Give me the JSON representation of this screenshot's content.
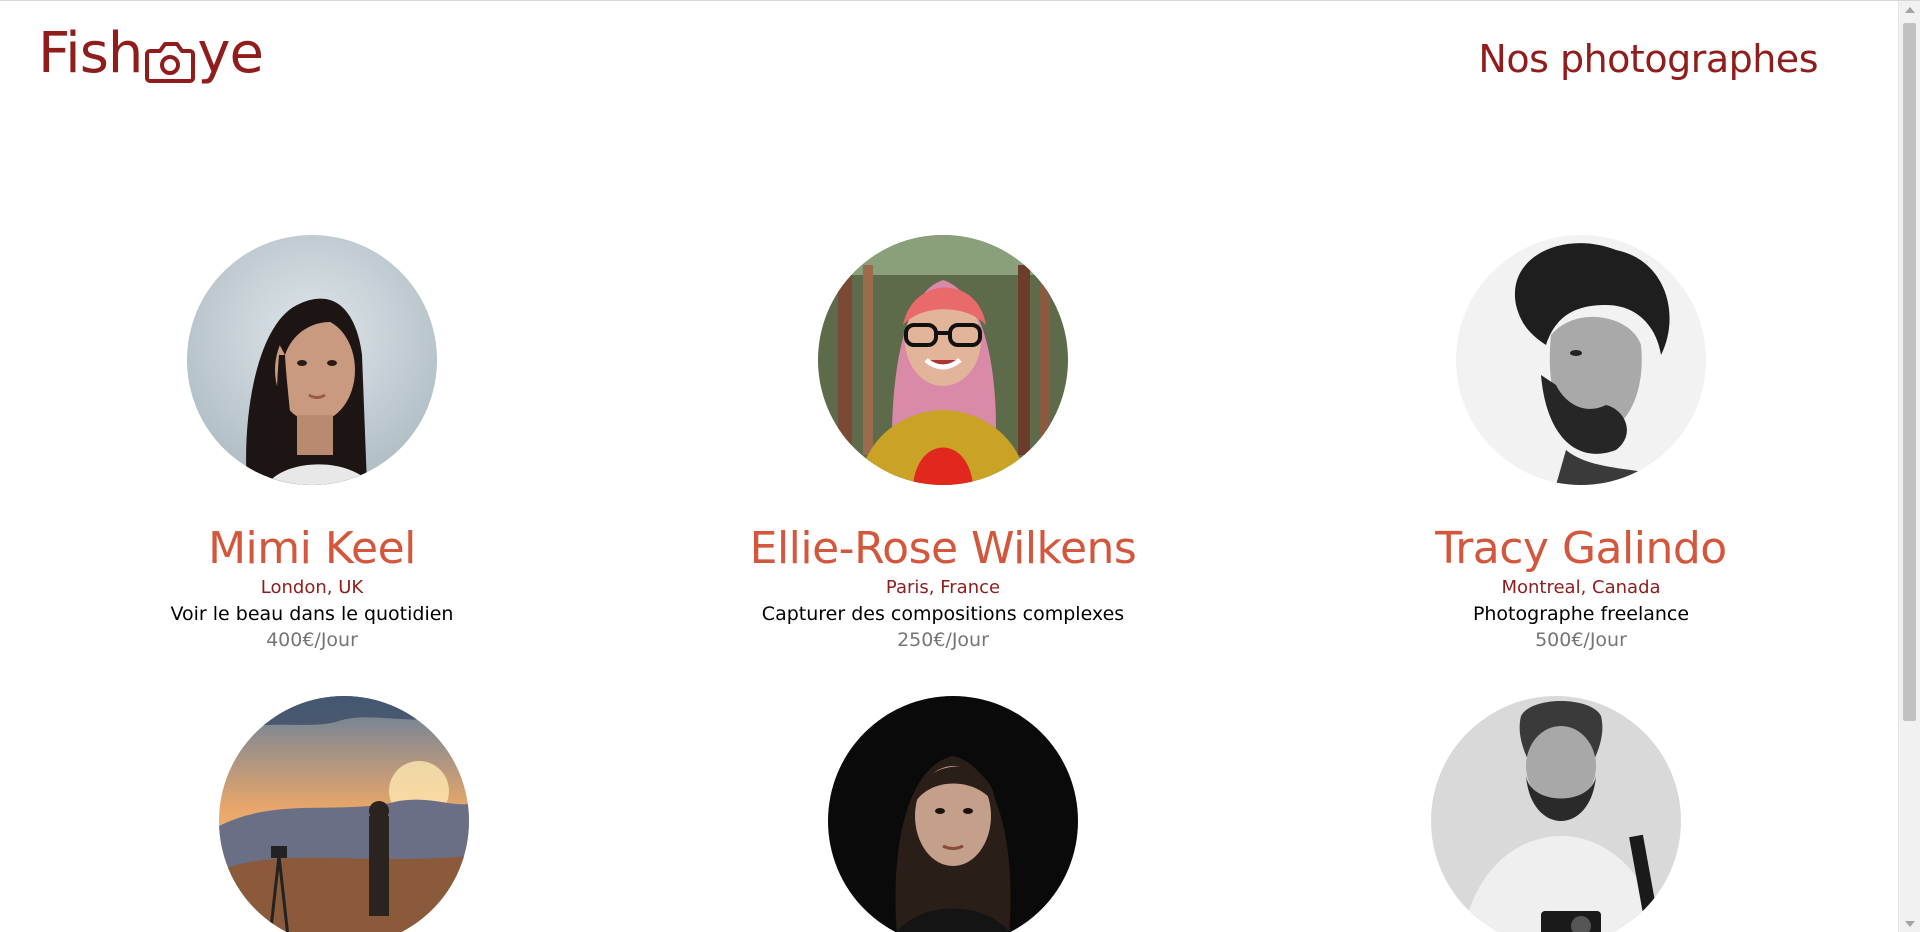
{
  "header": {
    "logo_text_before": "Fish",
    "logo_text_after": "ye",
    "logo_icon": "camera-icon",
    "heading": "Nos photographes",
    "brand_color": "#901C1C"
  },
  "colors": {
    "name": "#D3573C",
    "location": "#901C1C",
    "tagline": "#000000",
    "price": "#757575"
  },
  "photographers": [
    {
      "name": "Mimi Keel",
      "location": "London, UK",
      "tagline": "Voir le beau dans le quotidien",
      "price": "400€/Jour",
      "portrait": "woman-dark-hair-portrait"
    },
    {
      "name": "Ellie-Rose Wilkens",
      "location": "Paris, France",
      "tagline": "Capturer des compositions complexes",
      "price": "250€/Jour",
      "portrait": "woman-glasses-colorful-hair-portrait"
    },
    {
      "name": "Tracy Galindo",
      "location": "Montreal, Canada",
      "tagline": "Photographe freelance",
      "price": "500€/Jour",
      "portrait": "bearded-man-curly-hair-bw-portrait"
    },
    {
      "portrait": "sunset-mountain-photographer-portrait"
    },
    {
      "portrait": "woman-dark-background-portrait"
    },
    {
      "portrait": "bearded-man-camera-bw-portrait"
    }
  ]
}
